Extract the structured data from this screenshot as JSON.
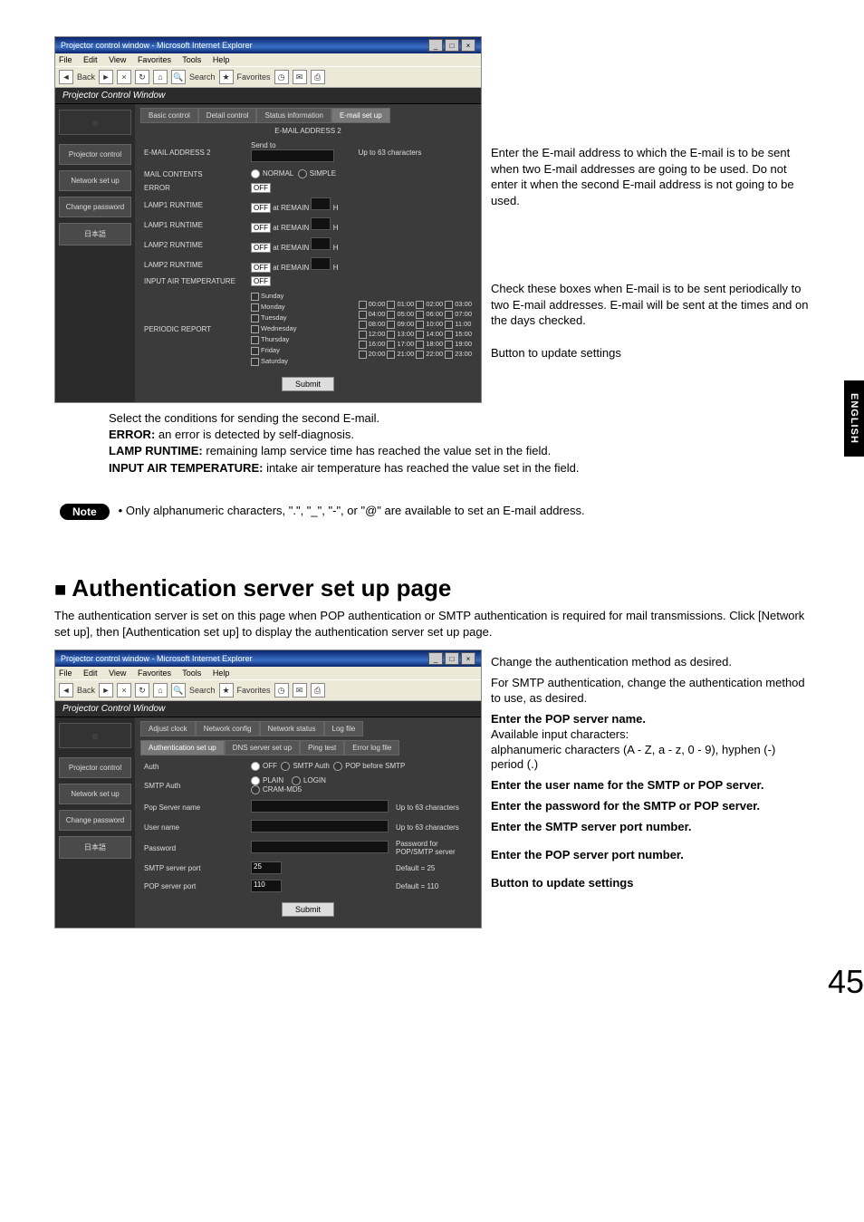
{
  "page_number": "45",
  "english_tab": "ENGLISH",
  "browser": {
    "title": "Projector control window - Microsoft Internet Explorer",
    "menu": [
      "File",
      "Edit",
      "View",
      "Favorites",
      "Tools",
      "Help"
    ],
    "tool_back": "Back",
    "tool_search": "Search",
    "tool_fav": "Favorites",
    "pcw": "Projector Control Window"
  },
  "screenshot1": {
    "tabs": [
      "Basic control",
      "Detail control",
      "Status information",
      "E-mail set up"
    ],
    "sub_header": "E-MAIL ADDRESS 2",
    "sidebar": [
      "Projector control",
      "Network set up",
      "Change password",
      "日本語"
    ],
    "rows": {
      "addr2": "E-MAIL ADDRESS 2",
      "sendto": "Send to",
      "upto": "Up to 63 characters",
      "mailcontents": "MAIL CONTENTS",
      "normal": "NORMAL",
      "simple": "SIMPLE",
      "error": "ERROR",
      "lamp1r": "LAMP1 RUNTIME",
      "lamp1r2": "LAMP1 RUNTIME",
      "lamp2r": "LAMP2 RUNTIME",
      "lamp2r2": "LAMP2 RUNTIME",
      "atremain": "at REMAIN",
      "h": "H",
      "inputair": "INPUT AIR TEMPERATURE",
      "periodic": "PERIODIC REPORT",
      "off": "OFF",
      "days": [
        "Sunday",
        "Monday",
        "Tuesday",
        "Wednesday",
        "Thursday",
        "Friday",
        "Saturday"
      ],
      "times": [
        [
          "00:00",
          "01:00",
          "02:00",
          "03:00"
        ],
        [
          "04:00",
          "05:00",
          "06:00",
          "07:00"
        ],
        [
          "08:00",
          "09:00",
          "10:00",
          "11:00"
        ],
        [
          "12:00",
          "13:00",
          "14:00",
          "15:00"
        ],
        [
          "16:00",
          "17:00",
          "18:00",
          "19:00"
        ],
        [
          "20:00",
          "21:00",
          "22:00",
          "23:00"
        ]
      ],
      "submit": "Submit"
    }
  },
  "callouts1": {
    "c1": "Enter the E-mail address to which the E-mail is to be sent when two E-mail addresses are going to be used. Do not enter it when the second E-mail address is not going to be used.",
    "c2": "Check these boxes when E-mail is to be sent periodically to two E-mail addresses. E-mail will be sent at the times and on the days checked.",
    "c3": "Button to update settings"
  },
  "mid_text": {
    "intro": "Select the conditions for sending the second E-mail.",
    "error_l": "ERROR:",
    "error_t": " an error is detected by self-diagnosis.",
    "lamp_l": "LAMP RUNTIME:",
    "lamp_t": " remaining lamp service time has reached the value set in the field.",
    "air_l": "INPUT AIR TEMPERATURE:",
    "air_t": " intake air temperature has reached the value set in the field."
  },
  "note": {
    "label": "Note",
    "text": "• Only alphanumeric characters, \".\", \"_\", \"-\", or \"@\" are available to set an E-mail address."
  },
  "auth_heading": "Authentication server set up page",
  "auth_intro": "The authentication server is set on this page when POP authentication or SMTP authentication is required for mail transmissions. Click [Network set up], then [Authentication set up] to display the authentication server set up page.",
  "screenshot2": {
    "tabs_top": [
      "Adjust clock",
      "Network config",
      "Network status",
      "Log file"
    ],
    "tabs_bottom": [
      "Authentication set up",
      "DNS server set up",
      "Ping test",
      "Error log file"
    ],
    "sidebar": [
      "Projector control",
      "Network set up",
      "Change password",
      "日本語"
    ],
    "rows": {
      "auth": "Auth",
      "off": "OFF",
      "smtpauth": "SMTP Auth",
      "popbefore": "POP before SMTP",
      "smtp_auth": "SMTP Auth",
      "plain": "PLAIN",
      "login": "LOGIN",
      "cram": "CRAM-MD5",
      "popserver": "Pop Server name",
      "upto63": "Up to 63 characters",
      "username": "User name",
      "upto63b": "Up to 63 characters",
      "password": "Password",
      "pwdfor": "Password for POP/SMTP server",
      "smtpport": "SMTP server port",
      "smtpport_v": "25",
      "smtpport_d": "Default = 25",
      "popport": "POP server port",
      "popport_v": "110",
      "popport_d": "Default = 110",
      "submit": "Submit"
    }
  },
  "callouts2": {
    "c1": "Change the authentication method as desired.",
    "c2": "For SMTP authentication, change the authentication method to use, as desired.",
    "c3a": "Enter the POP server name.",
    "c3b": "Available input characters:",
    "c3c": "alphanumeric characters (A - Z, a - z, 0 - 9), hyphen (-) period (.)",
    "c4a": "Enter the user name for the SMTP or POP server.",
    "c5a": "Enter the password for the SMTP or POP server.",
    "c6": "Enter the SMTP server port number.",
    "c7": "Enter the POP server port number.",
    "c8": "Button to update settings"
  }
}
